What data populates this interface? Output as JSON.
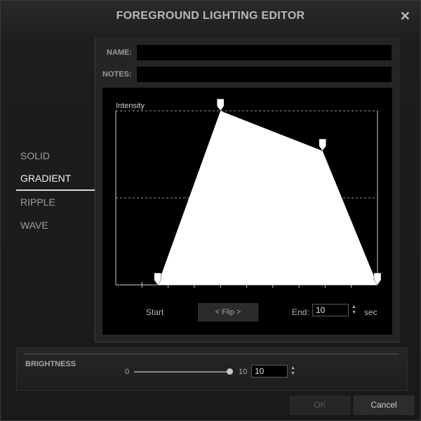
{
  "window": {
    "title": "FOREGROUND LIGHTING EDITOR",
    "close_symbol": "✕"
  },
  "nav": {
    "items": [
      {
        "label": "SOLID",
        "active": false
      },
      {
        "label": "GRADIENT",
        "active": true
      },
      {
        "label": "RIPPLE",
        "active": false
      },
      {
        "label": "WAVE",
        "active": false
      }
    ]
  },
  "form": {
    "name_label": "NAME:",
    "name_value": "",
    "notes_label": "NOTES:",
    "notes_value": ""
  },
  "graph": {
    "y_label": "Intensity",
    "duration": 10,
    "tick_count": 10,
    "reference_line": 0.5,
    "points": [
      {
        "t": 1.6,
        "intensity": 0
      },
      {
        "t": 4.0,
        "intensity": 1.0
      },
      {
        "t": 7.9,
        "intensity": 0.77
      },
      {
        "t": 10.0,
        "intensity": 0
      }
    ],
    "fill_color": "#ffffff"
  },
  "controls": {
    "start_label": "Start",
    "flip_label": "< Flip >",
    "end_label": "End:",
    "end_value": "10",
    "sec_label": "sec"
  },
  "brightness": {
    "title": "BRIGHTNESS",
    "min_label": "0",
    "max_label": "10",
    "value": "10",
    "level": 1.0
  },
  "buttons": {
    "ok_label": "OK",
    "cancel_label": "Cancel"
  }
}
